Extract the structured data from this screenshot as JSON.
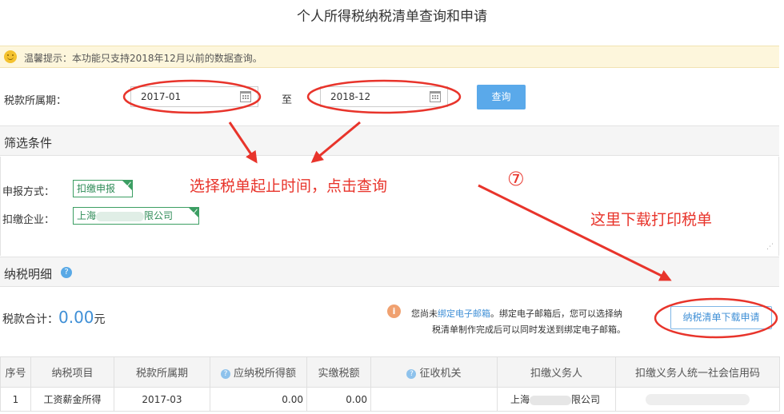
{
  "page_title": "个人所得税纳税清单查询和申请",
  "notice": {
    "icon": "smile-icon",
    "text": "温馨提示：本功能只支持2018年12月以前的数据查询。"
  },
  "period": {
    "label": "税款所属期：",
    "start": "2017-01",
    "separator": "至",
    "end": "2018-12",
    "query_label": "查询"
  },
  "filter": {
    "title": "筛选条件",
    "declare_label": "申报方式：",
    "declare_value": "扣缴申报",
    "company_label": "扣缴企业：",
    "company_prefix": "上海",
    "company_suffix": "限公司"
  },
  "detail": {
    "title": "纳税明细",
    "total_label": "税款合计：",
    "total_value": "0.00",
    "total_unit": "元",
    "email_note_1": "您尚未",
    "email_link": "绑定电子邮箱",
    "email_note_2": "。绑定电子邮箱后，您可以选择纳",
    "email_note_3": "税清单制作完成后可以同时发送到绑定电子邮箱。",
    "apply_label": "纳税清单下载申请"
  },
  "table": {
    "headers": [
      "序号",
      "纳税项目",
      "税款所属期",
      "应纳税所得额",
      "实缴税额",
      "征收机关",
      "扣缴义务人",
      "扣缴义务人统一社会信用码"
    ],
    "rows": [
      {
        "no": "1",
        "item": "工资薪金所得",
        "period": "2017-03",
        "taxable": "0.00",
        "paid": "0.00",
        "office": "",
        "agent_prefix": "上海",
        "agent_suffix": "限公司",
        "code": ""
      }
    ]
  },
  "annotations": {
    "instruction": "选择税单起止时间，点击查询",
    "step_marker": "⑦",
    "download_hint": "这里下载打印税单",
    "color": "#e8342b"
  }
}
